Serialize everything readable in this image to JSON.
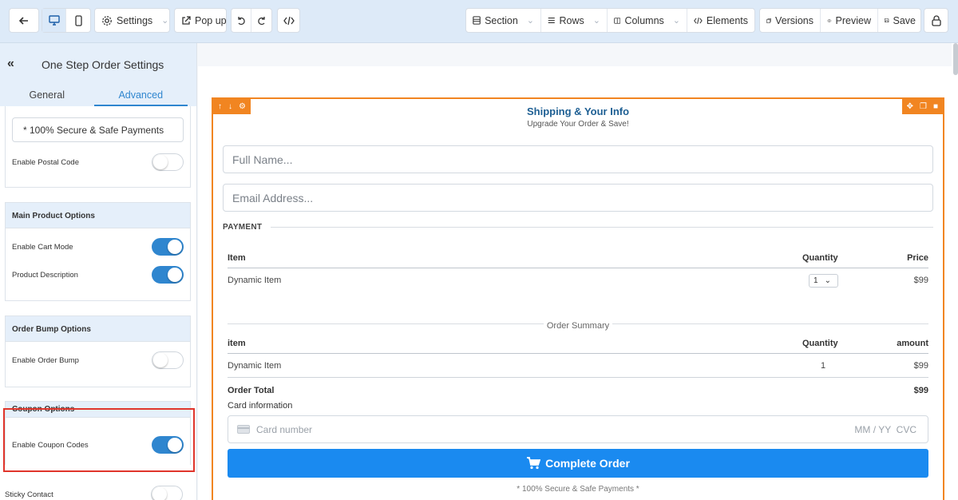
{
  "toolbar": {
    "settings": "Settings",
    "popup": "Pop up",
    "section": "Section",
    "rows": "Rows",
    "columns": "Columns",
    "elements": "Elements",
    "versions": "Versions",
    "preview": "Preview",
    "save": "Save"
  },
  "panel": {
    "title": "One Step Order Settings",
    "tabs": [
      "General",
      "Advanced"
    ],
    "active_tab": "Advanced",
    "footer_text_value": "* 100% Secure & Safe Payments",
    "enable_postal_code": "Enable Postal Code",
    "main_product": {
      "heading": "Main Product Options",
      "enable_cart_mode": "Enable Cart Mode",
      "product_description": "Product Description"
    },
    "order_bump": {
      "heading": "Order Bump Options",
      "enable_order_bump": "Enable Order Bump"
    },
    "coupon": {
      "heading": "Coupon Options",
      "enable_coupon_codes": "Enable Coupon Codes"
    },
    "sticky_contact": "Sticky Contact"
  },
  "form": {
    "title": "Shipping & Your Info",
    "subtitle": "Upgrade Your Order & Save!",
    "full_name_placeholder": "Full Name...",
    "email_placeholder": "Email Address...",
    "payment_label": "PAYMENT",
    "table1": {
      "col_item": "Item",
      "col_quantity": "Quantity",
      "col_price": "Price",
      "row_item": "Dynamic Item",
      "row_quantity": "1",
      "row_price": "$99"
    },
    "summary_label": "Order Summary",
    "table2": {
      "col_item": "item",
      "col_quantity": "Quantity",
      "col_amount": "amount",
      "row_item": "Dynamic Item",
      "row_quantity": "1",
      "row_amount": "$99",
      "total_label": "Order Total",
      "total_value": "$99"
    },
    "card_info_label": "Card information",
    "card_number_placeholder": "Card number",
    "card_expiry_cvc": "MM / YY  CVC",
    "button_label": "Complete Order",
    "footnote": "* 100% Secure & Safe Payments *"
  },
  "colors": {
    "accent": "#2f86cf",
    "section_border": "#f18521",
    "button": "#1a8af0",
    "highlight": "#e0352b"
  }
}
